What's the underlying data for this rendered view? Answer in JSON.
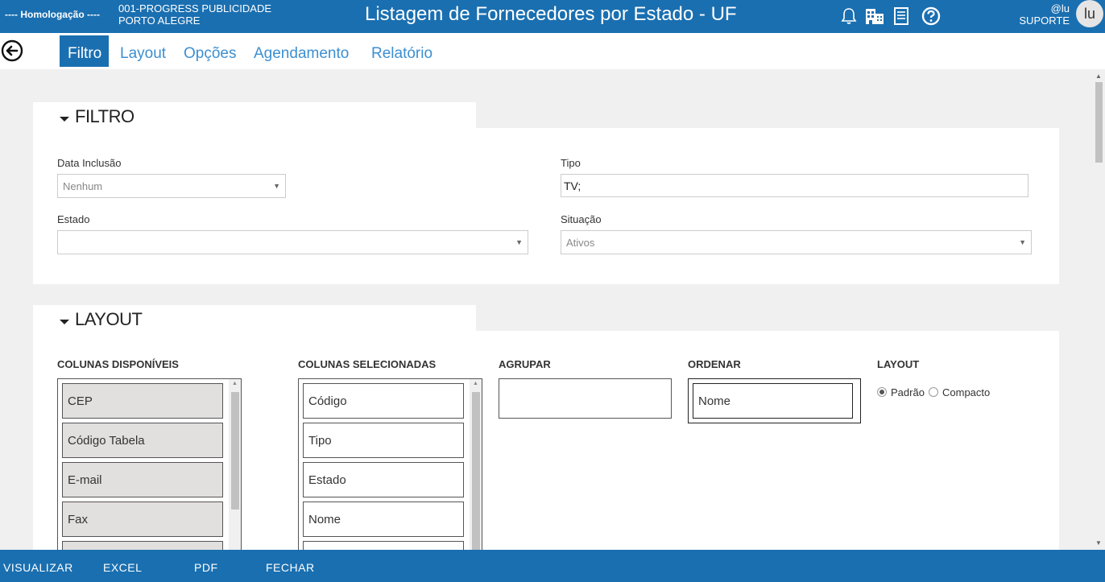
{
  "header": {
    "environment": "---- Homologação ----",
    "company_line1": "001-PROGRESS PUBLICIDADE",
    "company_line2": "PORTO ALEGRE",
    "title": "Listagem de Fornecedores por Estado - UF",
    "icons": [
      "bell-icon",
      "buildings-icon",
      "document-icon",
      "help-icon"
    ],
    "user_handle": "@lu",
    "user_role": "SUPORTE",
    "avatar_initials": "lu"
  },
  "tabs": [
    {
      "label": "Filtro",
      "active": true
    },
    {
      "label": "Layout",
      "active": false
    },
    {
      "label": "Opções",
      "active": false
    },
    {
      "label": "Agendamento",
      "active": false
    },
    {
      "label": "Relatório",
      "active": false
    }
  ],
  "filtro": {
    "title": "FILTRO",
    "data_inclusao": {
      "label": "Data Inclusão",
      "value": "Nenhum"
    },
    "tipo": {
      "label": "Tipo",
      "value": "TV;"
    },
    "estado": {
      "label": "Estado",
      "value": ""
    },
    "situacao": {
      "label": "Situação",
      "value": "Ativos"
    }
  },
  "layout": {
    "title": "LAYOUT",
    "colunas_disponiveis": {
      "label": "COLUNAS DISPONÍVEIS",
      "items": [
        "CEP",
        "Código Tabela",
        "E-mail",
        "Fax"
      ]
    },
    "colunas_selecionadas": {
      "label": "COLUNAS SELECIONADAS",
      "items": [
        "Código",
        "Tipo",
        "Estado",
        "Nome"
      ]
    },
    "agrupar": {
      "label": "AGRUPAR",
      "items": []
    },
    "ordenar": {
      "label": "ORDENAR",
      "items": [
        "Nome"
      ]
    },
    "layout_option": {
      "label": "LAYOUT",
      "options": [
        "Padrão",
        "Compacto"
      ],
      "selected": "Padrão"
    }
  },
  "footer": {
    "visualizar": "VISUALIZAR",
    "excel": "EXCEL",
    "pdf": "PDF",
    "fechar": "FECHAR"
  },
  "colors": {
    "primary": "#1a6fb0",
    "tab_link": "#3d8fd1",
    "background": "#f0f0f0"
  }
}
